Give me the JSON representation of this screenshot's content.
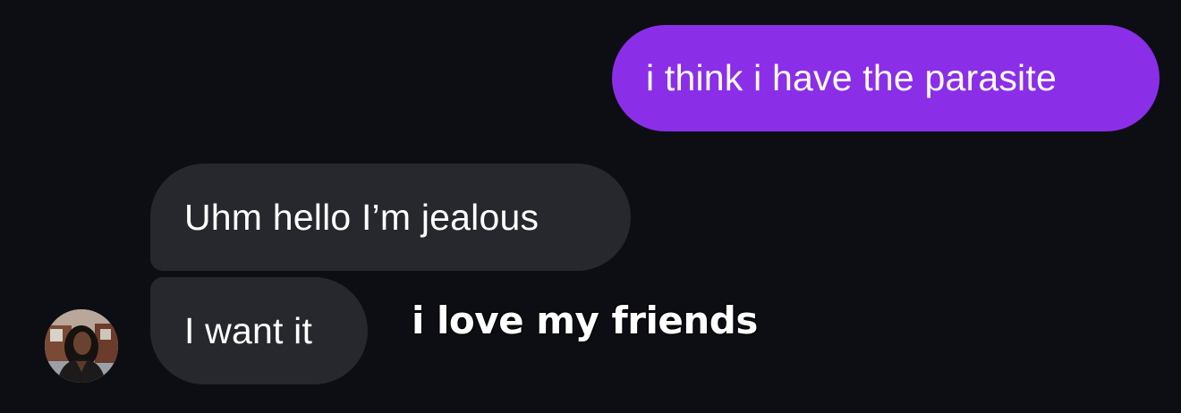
{
  "conversation": {
    "messages": [
      {
        "direction": "sent",
        "text": "i think i have the parasite"
      },
      {
        "direction": "received",
        "text": "Uhm hello I’m jealous"
      },
      {
        "direction": "received",
        "text": "I want it"
      }
    ]
  },
  "overlay": {
    "caption": "i love my friends"
  },
  "colors": {
    "background": "#0c0e13",
    "sent_bubble": "#8b2ee8",
    "received_bubble": "#26282d",
    "text": "#ffffff"
  },
  "icons": {
    "avatar": "contact-avatar-photo"
  }
}
